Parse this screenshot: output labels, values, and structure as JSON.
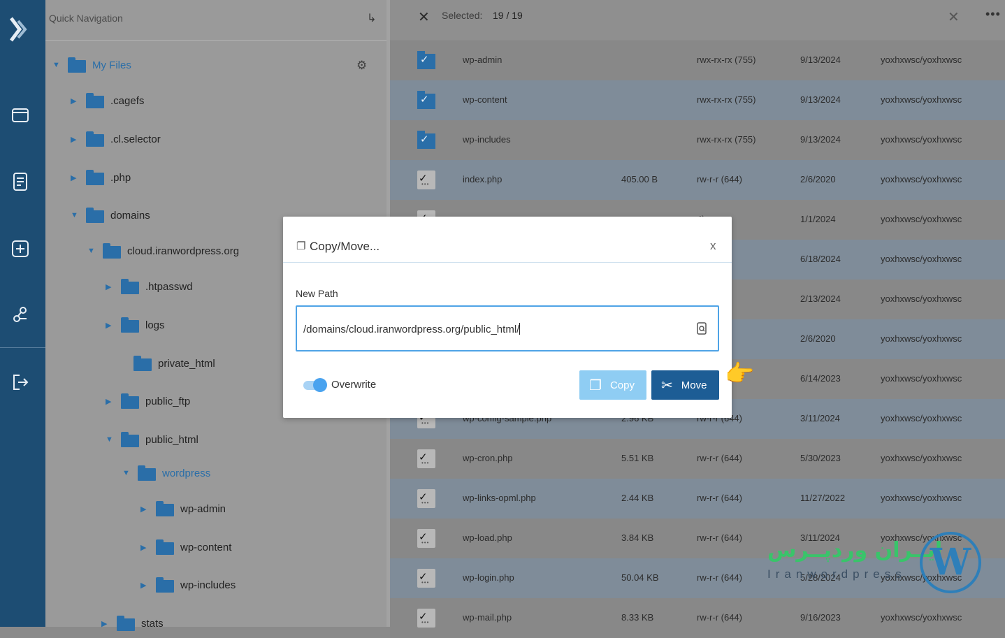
{
  "rail": {
    "icons": [
      "logo-chevron-icon",
      "folder-icon",
      "document-icon",
      "add-icon",
      "share-icon",
      "logout-icon"
    ]
  },
  "quick_nav": {
    "title": "Quick Navigation",
    "collapse_glyph": "↳",
    "tree": [
      {
        "label": "My Files",
        "arrow": "▼",
        "active": true
      },
      {
        "label": ".cagefs",
        "arrow": "▶"
      },
      {
        "label": ".cl.selector",
        "arrow": "▶"
      },
      {
        "label": ".php",
        "arrow": "▶"
      },
      {
        "label": "domains",
        "arrow": "▼"
      },
      {
        "label": "cloud.iranwordpress.org",
        "arrow": "▼"
      },
      {
        "label": ".htpasswd",
        "arrow": "▶"
      },
      {
        "label": "logs",
        "arrow": "▶"
      },
      {
        "label": "private_html",
        "arrow": ""
      },
      {
        "label": "public_ftp",
        "arrow": "▶"
      },
      {
        "label": "public_html",
        "arrow": "▼"
      },
      {
        "label": "wordpress",
        "arrow": "▼",
        "active": true
      },
      {
        "label": "wp-admin",
        "arrow": "▶"
      },
      {
        "label": "wp-content",
        "arrow": "▶"
      },
      {
        "label": "wp-includes",
        "arrow": "▶"
      },
      {
        "label": "stats",
        "arrow": "▶"
      }
    ]
  },
  "list_header": {
    "selected_label": "Selected:",
    "selected_count": "19 / 19"
  },
  "files": [
    {
      "name": "wp-admin",
      "type": "folder",
      "size": "",
      "perm": "rwx-rx-rx (755)",
      "date": "9/13/2024",
      "owner": "yoxhxwsc/yoxhxwsc"
    },
    {
      "name": "wp-content",
      "type": "folder",
      "size": "",
      "perm": "rwx-rx-rx (755)",
      "date": "9/13/2024",
      "owner": "yoxhxwsc/yoxhxwsc"
    },
    {
      "name": "wp-includes",
      "type": "folder",
      "size": "",
      "perm": "rwx-rx-rx (755)",
      "date": "9/13/2024",
      "owner": "yoxhxwsc/yoxhxwsc"
    },
    {
      "name": "index.php",
      "type": "file",
      "size": "405.00 B",
      "perm": "rw-r-r (644)",
      "date": "2/6/2020",
      "owner": "yoxhxwsc/yoxhxwsc"
    },
    {
      "name": "",
      "type": "file",
      "size": "",
      "perm": "4)",
      "date": "1/1/2024",
      "owner": "yoxhxwsc/yoxhxwsc"
    },
    {
      "name": "",
      "type": "file",
      "size": "",
      "perm": "4)",
      "date": "6/18/2024",
      "owner": "yoxhxwsc/yoxhxwsc"
    },
    {
      "name": "",
      "type": "file",
      "size": "",
      "perm": "4)",
      "date": "2/13/2024",
      "owner": "yoxhxwsc/yoxhxwsc"
    },
    {
      "name": "",
      "type": "file",
      "size": "",
      "perm": "4)",
      "date": "2/6/2020",
      "owner": "yoxhxwsc/yoxhxwsc"
    },
    {
      "name": "",
      "type": "file",
      "size": "",
      "perm": "4)",
      "date": "6/14/2023",
      "owner": "yoxhxwsc/yoxhxwsc"
    },
    {
      "name": "wp-config-sample.php",
      "type": "file",
      "size": "2.96 KB",
      "perm": "rw-r-r (644)",
      "date": "3/11/2024",
      "owner": "yoxhxwsc/yoxhxwsc"
    },
    {
      "name": "wp-cron.php",
      "type": "file",
      "size": "5.51 KB",
      "perm": "rw-r-r (644)",
      "date": "5/30/2023",
      "owner": "yoxhxwsc/yoxhxwsc"
    },
    {
      "name": "wp-links-opml.php",
      "type": "file",
      "size": "2.44 KB",
      "perm": "rw-r-r (644)",
      "date": "11/27/2022",
      "owner": "yoxhxwsc/yoxhxwsc"
    },
    {
      "name": "wp-load.php",
      "type": "file",
      "size": "3.84 KB",
      "perm": "rw-r-r (644)",
      "date": "3/11/2024",
      "owner": "yoxhxwsc/yoxhxwsc"
    },
    {
      "name": "wp-login.php",
      "type": "file",
      "size": "50.04 KB",
      "perm": "rw-r-r (644)",
      "date": "5/28/2024",
      "owner": "yoxhxwsc/yoxhxwsc"
    },
    {
      "name": "wp-mail.php",
      "type": "file",
      "size": "8.33 KB",
      "perm": "rw-r-r (644)",
      "date": "9/16/2023",
      "owner": "yoxhxwsc/yoxhxwsc"
    }
  ],
  "modal": {
    "title": "Copy/Move...",
    "close": "x",
    "path_label": "New Path",
    "path_value": "/domains/cloud.iranwordpress.org/public_html/",
    "overwrite_label": "Overwrite",
    "overwrite_on": true,
    "copy_label": "Copy",
    "move_label": "Move"
  },
  "watermark": {
    "persian": "ایــران وردپــرس",
    "latin": "Iranwordpress",
    "logo_letter": "W"
  },
  "colors": {
    "rail": "#1d4d73",
    "accent": "#2a6ea8",
    "move_button": "#1d5d95",
    "copy_button": "#8fcdf3"
  }
}
